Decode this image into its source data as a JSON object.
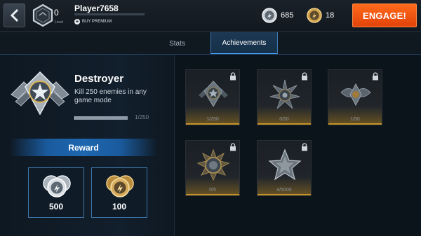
{
  "header": {
    "player_name": "Player7658",
    "level_value": "0",
    "level_label": "Level",
    "buy_premium_label": "BUY PREMIUM",
    "currencies": [
      {
        "icon": "silver-coin-icon",
        "value": "685"
      },
      {
        "icon": "gold-coin-icon",
        "value": "18"
      }
    ],
    "engage_label": "ENGAGE!"
  },
  "tabs": [
    {
      "label": "Stats",
      "active": false
    },
    {
      "label": "Achievements",
      "active": true
    }
  ],
  "selected_achievement": {
    "title": "Destroyer",
    "description": "Kill 250 enemies in any game mode",
    "progress_text": "1/250",
    "progress_fraction": 0.004
  },
  "reward": {
    "title": "Reward",
    "items": [
      {
        "icon": "silver-coins-icon",
        "value": "500"
      },
      {
        "icon": "gold-coins-icon",
        "value": "100"
      }
    ]
  },
  "achievements": [
    {
      "icon": "destroyer-medal-icon",
      "progress": "1/250",
      "locked": true
    },
    {
      "icon": "burst-medal-icon",
      "progress": "0/50",
      "locked": true
    },
    {
      "icon": "wings-medal-icon",
      "progress": "1/50",
      "locked": true
    },
    {
      "icon": "sunburst-medal-icon",
      "progress": "0/5",
      "locked": true
    },
    {
      "icon": "star-medal-icon",
      "progress": "4/5000",
      "locked": true
    }
  ],
  "colors": {
    "accent": "#4aa3ff",
    "engage": "#f0541a",
    "gold": "#c49327"
  }
}
